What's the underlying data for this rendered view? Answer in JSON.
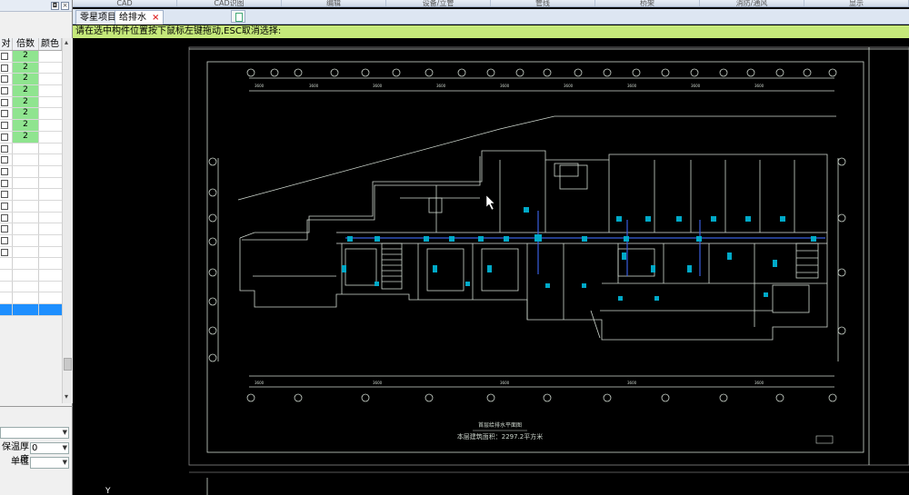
{
  "ribbon": {
    "labels": [
      "CAD",
      "CAD识图",
      "编辑",
      "设备/立管",
      "管线",
      "桥架",
      "消防/通风",
      "显示"
    ]
  },
  "left_panel": {
    "grid": {
      "headers": [
        "对",
        "倍数",
        "颜色"
      ],
      "rows": [
        {
          "multiplier": "2",
          "green": true
        },
        {
          "multiplier": "2",
          "green": true
        },
        {
          "multiplier": "2",
          "green": true
        },
        {
          "multiplier": "2",
          "green": true
        },
        {
          "multiplier": "2",
          "green": true
        },
        {
          "multiplier": "2",
          "green": true
        },
        {
          "multiplier": "2",
          "green": true
        },
        {
          "multiplier": "2",
          "green": true
        }
      ]
    },
    "props": [
      {
        "label": "",
        "value": ""
      },
      {
        "label": "保温厚度",
        "value": "0"
      },
      {
        "label": "单位",
        "value": ""
      }
    ]
  },
  "tabs": [
    {
      "label": "零星项目"
    },
    {
      "label": "给排水"
    }
  ],
  "prompt_text": "请在选中构件位置按下鼠标左键拖动,ESC取消选择:",
  "drawing": {
    "caption_line1": "首层给排水平面图",
    "caption_line2": "本层建筑面积：2297.2平方米"
  },
  "colors": {
    "canvas": "#000000",
    "prompt_bg": "#c5e97a",
    "selection": "#1e8fff",
    "accent_cyan": "#00b4d8"
  }
}
